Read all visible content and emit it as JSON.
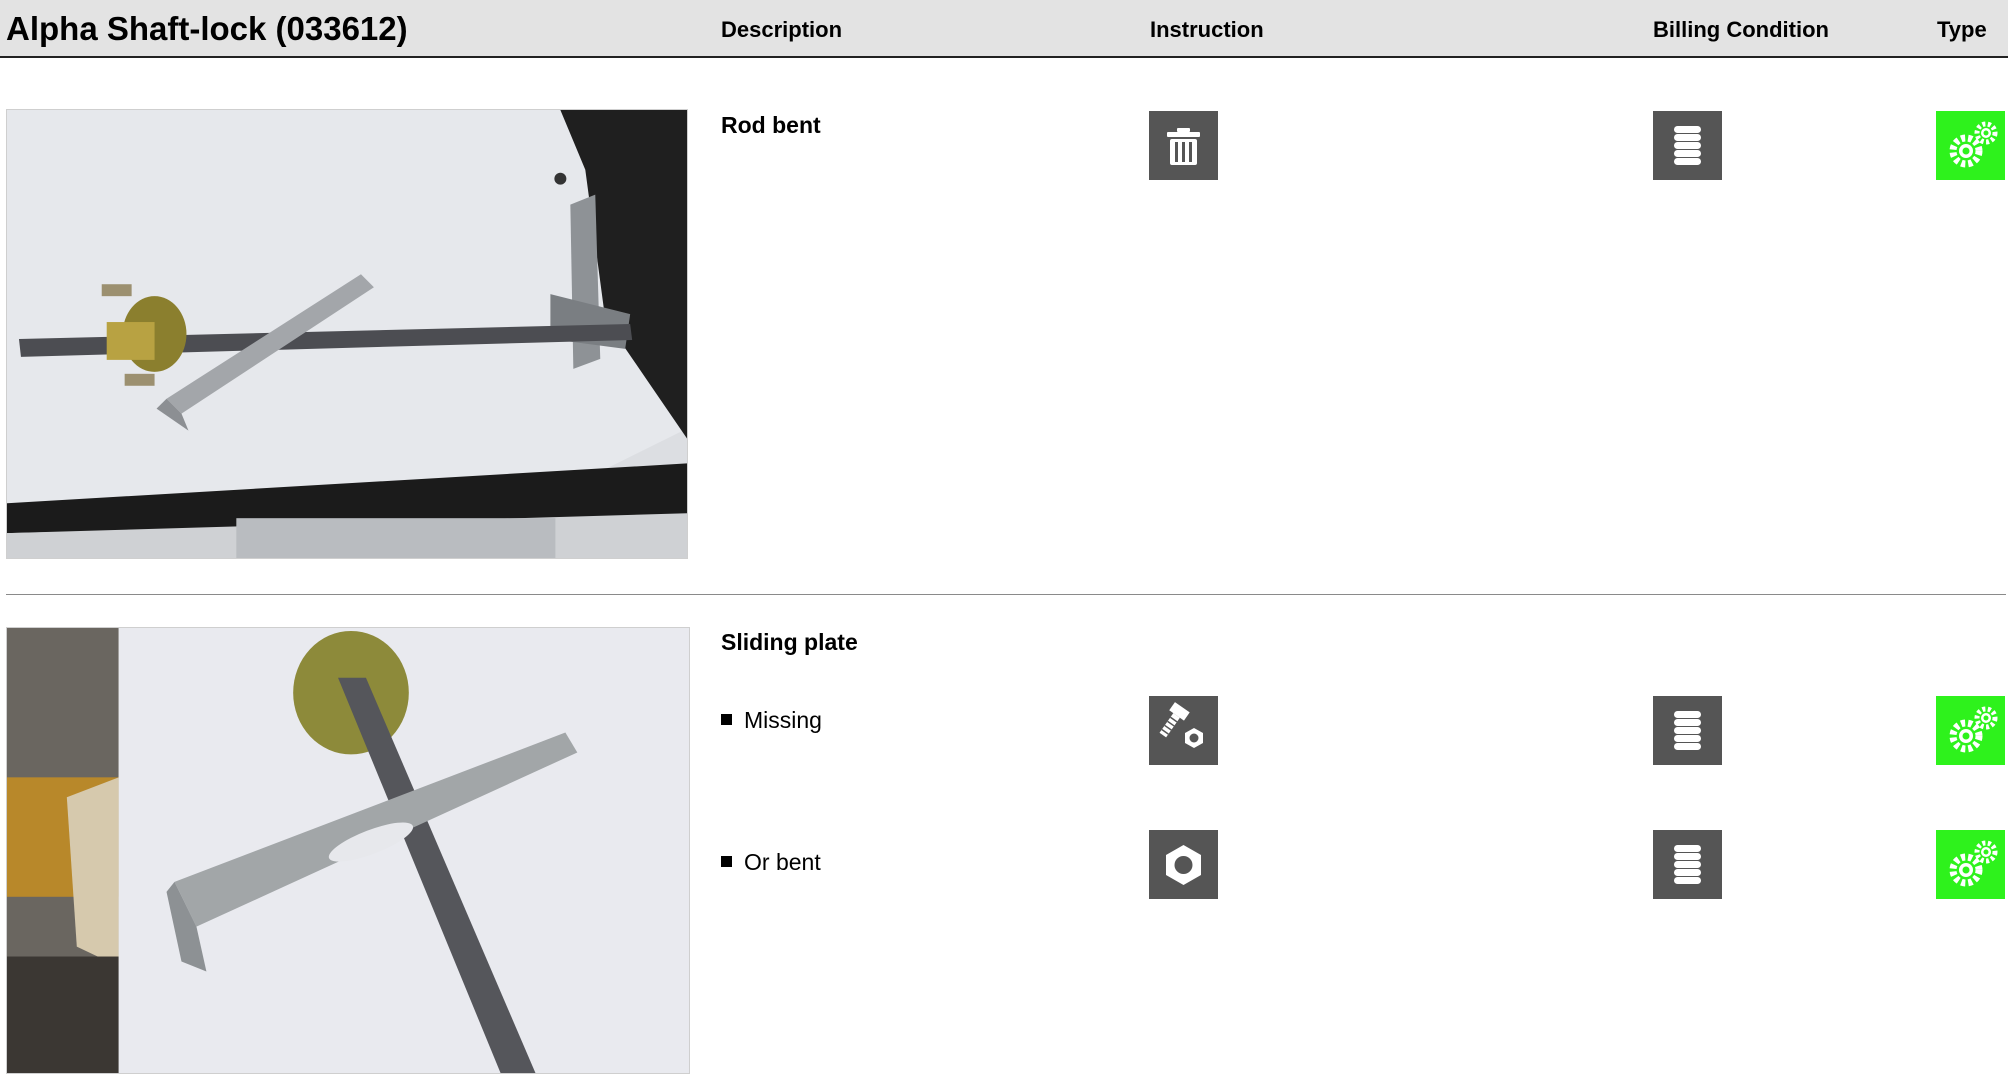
{
  "header": {
    "title": "Alpha Shaft-lock (033612)",
    "columns": {
      "description": "Description",
      "instruction": "Instruction",
      "billing": "Billing Condition",
      "type": "Type"
    }
  },
  "sections": [
    {
      "photo_icon": "shaft-lock-rod-photo",
      "description": "Rod bent",
      "rows": [
        {
          "label": "",
          "instruction_icon": "trash-icon",
          "billing_icon": "coin-stack-icon",
          "type_icon": "gears-icon"
        }
      ]
    },
    {
      "photo_icon": "sliding-plate-photo",
      "description": "Sliding plate",
      "rows": [
        {
          "label": "Missing",
          "instruction_icon": "bolt-nut-icon",
          "billing_icon": "coin-stack-icon",
          "type_icon": "gears-icon"
        },
        {
          "label": "Or bent",
          "instruction_icon": "nut-icon",
          "billing_icon": "coin-stack-icon",
          "type_icon": "gears-icon"
        }
      ]
    }
  ],
  "colors": {
    "header_bg": "#e3e3e3",
    "icon_dark": "#555555",
    "icon_green": "#2ef21c"
  }
}
